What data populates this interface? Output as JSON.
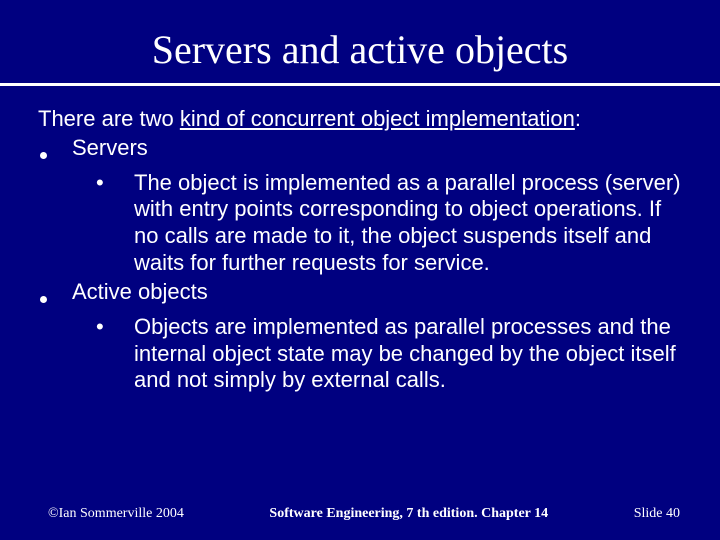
{
  "title": "Servers and active objects",
  "intro": {
    "plain": "There are two ",
    "underlined": "kind of concurrent object implementation",
    "tail": ":"
  },
  "items": [
    {
      "label": "Servers",
      "sub": "The object is implemented as a parallel process (server) with entry points corresponding to object operations. If no calls are made to it, the object suspends itself and waits for further requests for service."
    },
    {
      "label": "Active objects",
      "sub": "Objects are implemented as parallel processes and the internal object state may be changed by the object itself and not simply by external calls."
    }
  ],
  "sub_marker": "•",
  "footer": {
    "left": "©Ian Sommerville 2004",
    "center": "Software Engineering, 7 th edition. Chapter 14",
    "right": "Slide  40"
  }
}
